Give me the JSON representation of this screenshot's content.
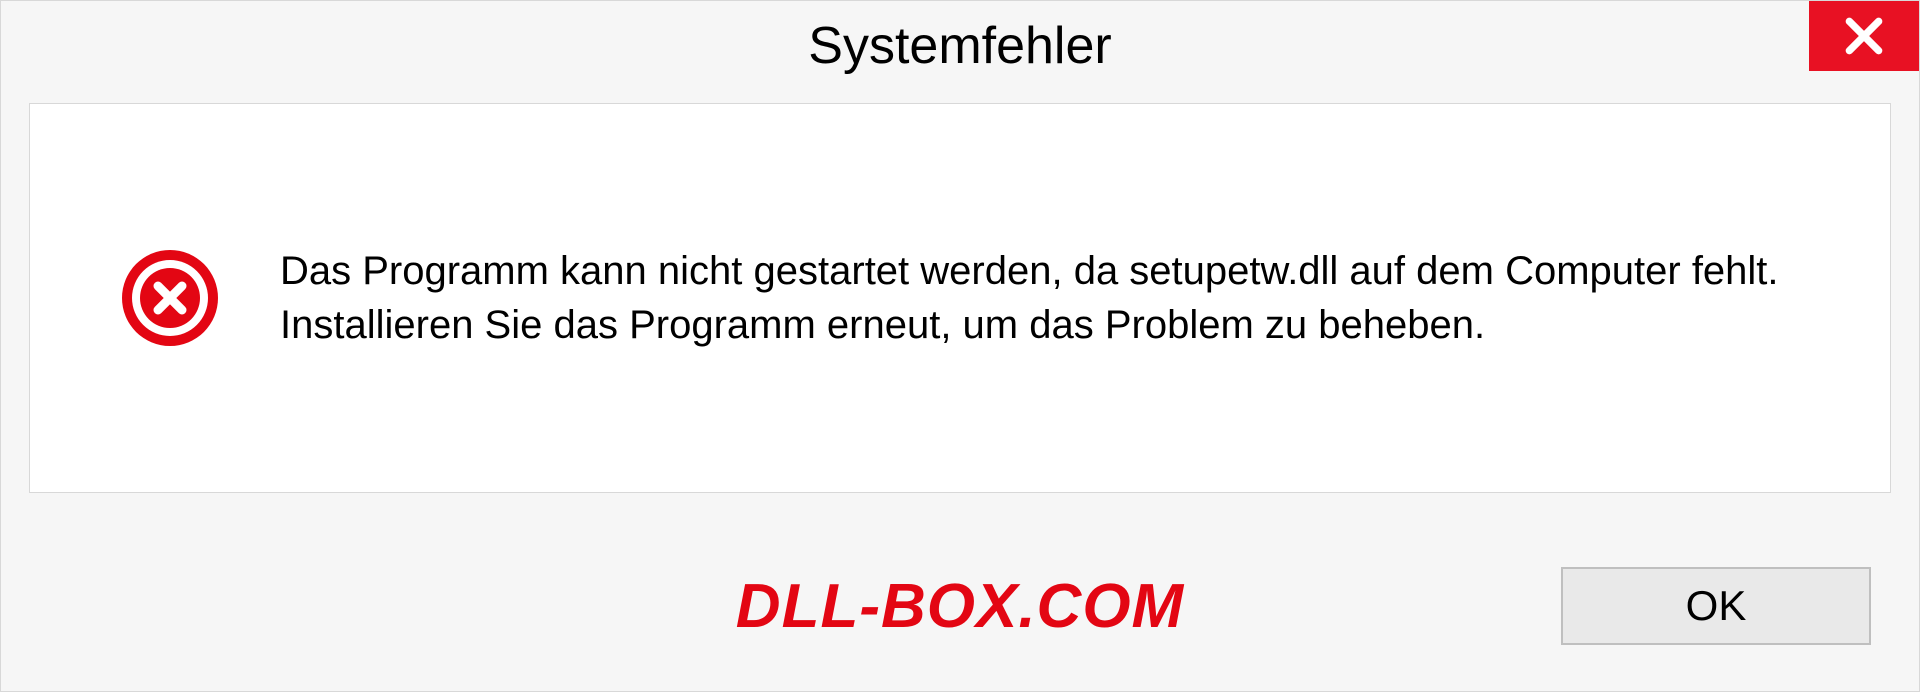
{
  "dialog": {
    "title": "Systemfehler",
    "message": "Das Programm kann nicht gestartet werden, da setupetw.dll auf dem Computer fehlt. Installieren Sie das Programm erneut, um das Problem zu beheben.",
    "ok_label": "OK"
  },
  "watermark": "DLL-BOX.COM"
}
